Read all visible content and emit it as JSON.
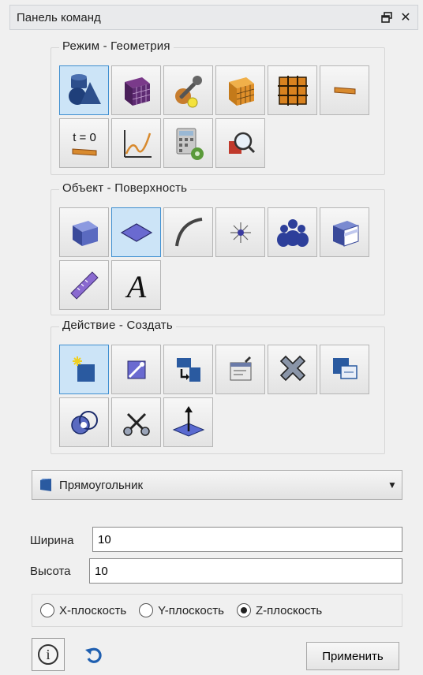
{
  "panel": {
    "title": "Панель команд",
    "icons": [
      "restore-icon",
      "close-icon"
    ]
  },
  "mode_group": {
    "legend": "Режим - Геометрия",
    "tools": [
      {
        "icon": "geometry-mode-icon",
        "active": true
      },
      {
        "icon": "mesh-mode-icon",
        "active": false
      },
      {
        "icon": "tools-mode-icon",
        "active": false
      },
      {
        "icon": "volume-mesh-icon",
        "active": false
      },
      {
        "icon": "block-mode-icon",
        "active": false
      },
      {
        "icon": "material-icon",
        "active": false
      },
      {
        "icon": "time-step-icon",
        "label": "t = 0",
        "active": false
      },
      {
        "icon": "graph-icon",
        "active": false
      },
      {
        "icon": "calculator-icon",
        "active": false
      },
      {
        "icon": "inspect-icon",
        "active": false
      }
    ]
  },
  "object_group": {
    "legend": "Объект - Поверхность",
    "tools": [
      {
        "icon": "solid-body-icon",
        "active": false
      },
      {
        "icon": "surface-icon",
        "active": true
      },
      {
        "icon": "curve-icon",
        "active": false
      },
      {
        "icon": "point-icon",
        "active": false
      },
      {
        "icon": "group-icon",
        "active": false
      },
      {
        "icon": "layered-body-icon",
        "active": false
      },
      {
        "icon": "ruler-icon",
        "active": false
      },
      {
        "icon": "text-icon",
        "label": "A",
        "active": false
      }
    ]
  },
  "action_group": {
    "legend": "Действие - Создать",
    "tools": [
      {
        "icon": "create-icon",
        "active": true
      },
      {
        "icon": "edit-icon",
        "active": false
      },
      {
        "icon": "transform-icon",
        "active": false
      },
      {
        "icon": "properties-icon",
        "active": false
      },
      {
        "icon": "delete-icon",
        "active": false
      },
      {
        "icon": "copy-icon",
        "active": false
      },
      {
        "icon": "intersect-icon",
        "active": false
      },
      {
        "icon": "cut-icon",
        "active": false
      },
      {
        "icon": "extrude-icon",
        "active": false
      }
    ]
  },
  "shape_select": {
    "icon": "rectangle-shape-icon",
    "value": "Прямоугольник"
  },
  "width": {
    "label": "Ширина",
    "value": "10"
  },
  "height": {
    "label": "Высота",
    "value": "10"
  },
  "plane": {
    "options": [
      "X-плоскость",
      "Y-плоскость",
      "Z-плоскость"
    ],
    "selected": "Z-плоскость"
  },
  "footer": {
    "info_icon": "info-icon",
    "reset_icon": "reset-icon",
    "apply_label": "Применить"
  },
  "colors": {
    "accent": "#3f8fd0",
    "active_bg": "#cce4f7",
    "icon_blue": "#2d4f8c",
    "icon_orange": "#d97b1c"
  }
}
